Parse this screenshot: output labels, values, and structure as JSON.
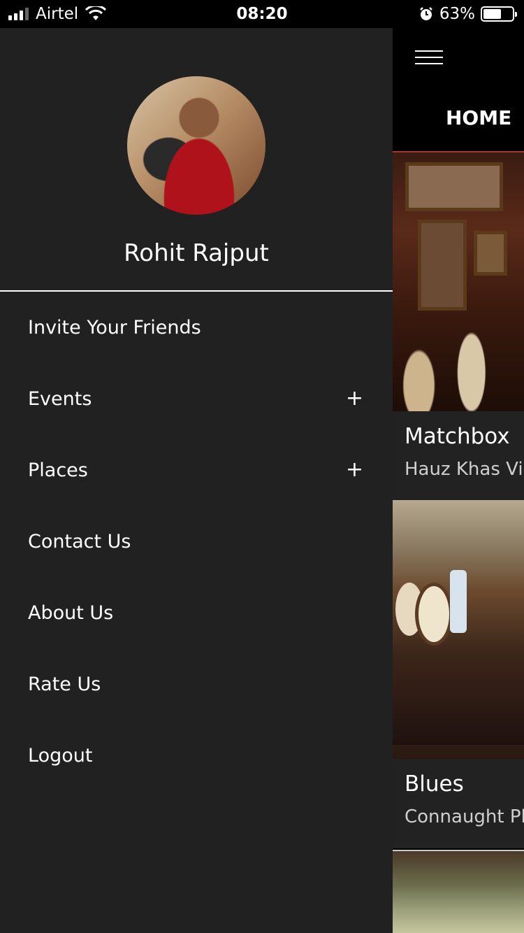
{
  "status_bar": {
    "carrier": "Airtel",
    "time": "08:20",
    "battery_percent": "63%",
    "battery_level": 0.63,
    "signal_bars": 4,
    "icons": [
      "signal-icon",
      "wifi-icon",
      "alarm-icon",
      "battery-icon"
    ]
  },
  "drawer": {
    "profile": {
      "name": "Rohit Rajput"
    },
    "menu": [
      {
        "label": "Invite Your Friends",
        "expandable": false
      },
      {
        "label": "Events",
        "expandable": true,
        "expand_glyph": "+"
      },
      {
        "label": "Places",
        "expandable": true,
        "expand_glyph": "+"
      },
      {
        "label": "Contact Us",
        "expandable": false
      },
      {
        "label": "About Us",
        "expandable": false
      },
      {
        "label": "Rate Us",
        "expandable": false
      },
      {
        "label": "Logout",
        "expandable": false
      }
    ]
  },
  "main": {
    "title": "HOME",
    "cards": [
      {
        "name": "Matchbox",
        "location": "Hauz Khas Vil"
      },
      {
        "name": "Blues",
        "location": "Connaught Pla"
      },
      {
        "name": "",
        "location": ""
      }
    ]
  },
  "colors": {
    "drawer_bg": "#212121",
    "main_bg": "#000000",
    "text": "#ffffff",
    "card_info_bg": "#222222"
  }
}
